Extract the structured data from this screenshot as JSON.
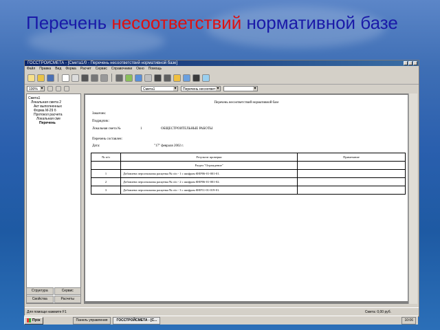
{
  "slide": {
    "title_part1": "Перечень ",
    "title_part2": "несоответствий",
    "title_part3": " нормативной базе"
  },
  "app": {
    "window_title": "ГОССТРОЙСМЕТА - [Смета1/0 - Перечень несоответствий нормативной базе]",
    "menu": [
      "Файл",
      "Правка",
      "Вид",
      "Форма",
      "Расчет",
      "Сервис",
      "Справочники",
      "Окно",
      "Помощь"
    ],
    "zoom": "100%",
    "combo1": "Смета1",
    "combo2": "Перечень несоответ"
  },
  "tree": [
    "Смета1",
    "Локальная смета 2",
    "Акт выполненных",
    "Форма М-29 б",
    "Протокол расчета",
    "Локальная сме",
    "Перечень"
  ],
  "left_tabs": [
    "Структура",
    "Сервис",
    "Свойства",
    "Расчеты"
  ],
  "doc": {
    "header": "Перечень несоответствий нормативной базе",
    "customer": "Заказчик:",
    "contractor": "Подрядчик:",
    "local_estimate_label": "Локальная смета №",
    "local_estimate_num": "1",
    "local_estimate_name": "ОБЩЕСТРОИТЕЛЬНЫЕ РАБОТЫ",
    "compiled_by": "Перечень составлен:",
    "date_label": "Дата:",
    "date_value": "\"17\" февраля 2002 г.",
    "columns": [
      "№ п/п",
      "Результат проверки",
      "Примечание"
    ],
    "section": "Раздел \"Ограждение\"",
    "rows": [
      {
        "n": "1",
        "text": "Добавлена персональная расценка № п/п - 1 с шифром ФЕР06-01-001-01.",
        "note": ""
      },
      {
        "n": "2",
        "text": "Добавлена персональная расценка № п/п - 2 с шифром ФЕР06-01-001-02.",
        "note": ""
      },
      {
        "n": "3",
        "text": "Добавлена персональная расценка № п/п - 3 с шифром ФЕР11-01-019-01.",
        "note": ""
      }
    ]
  },
  "status": {
    "left": "Для помощи нажмите F1",
    "right": "Смета: 0,00 руб."
  },
  "taskbar": {
    "start": "Пуск",
    "task1": "Панель управления",
    "task2": "ГОССТРОЙСМЕТА - [С...",
    "clock": "10:06"
  }
}
